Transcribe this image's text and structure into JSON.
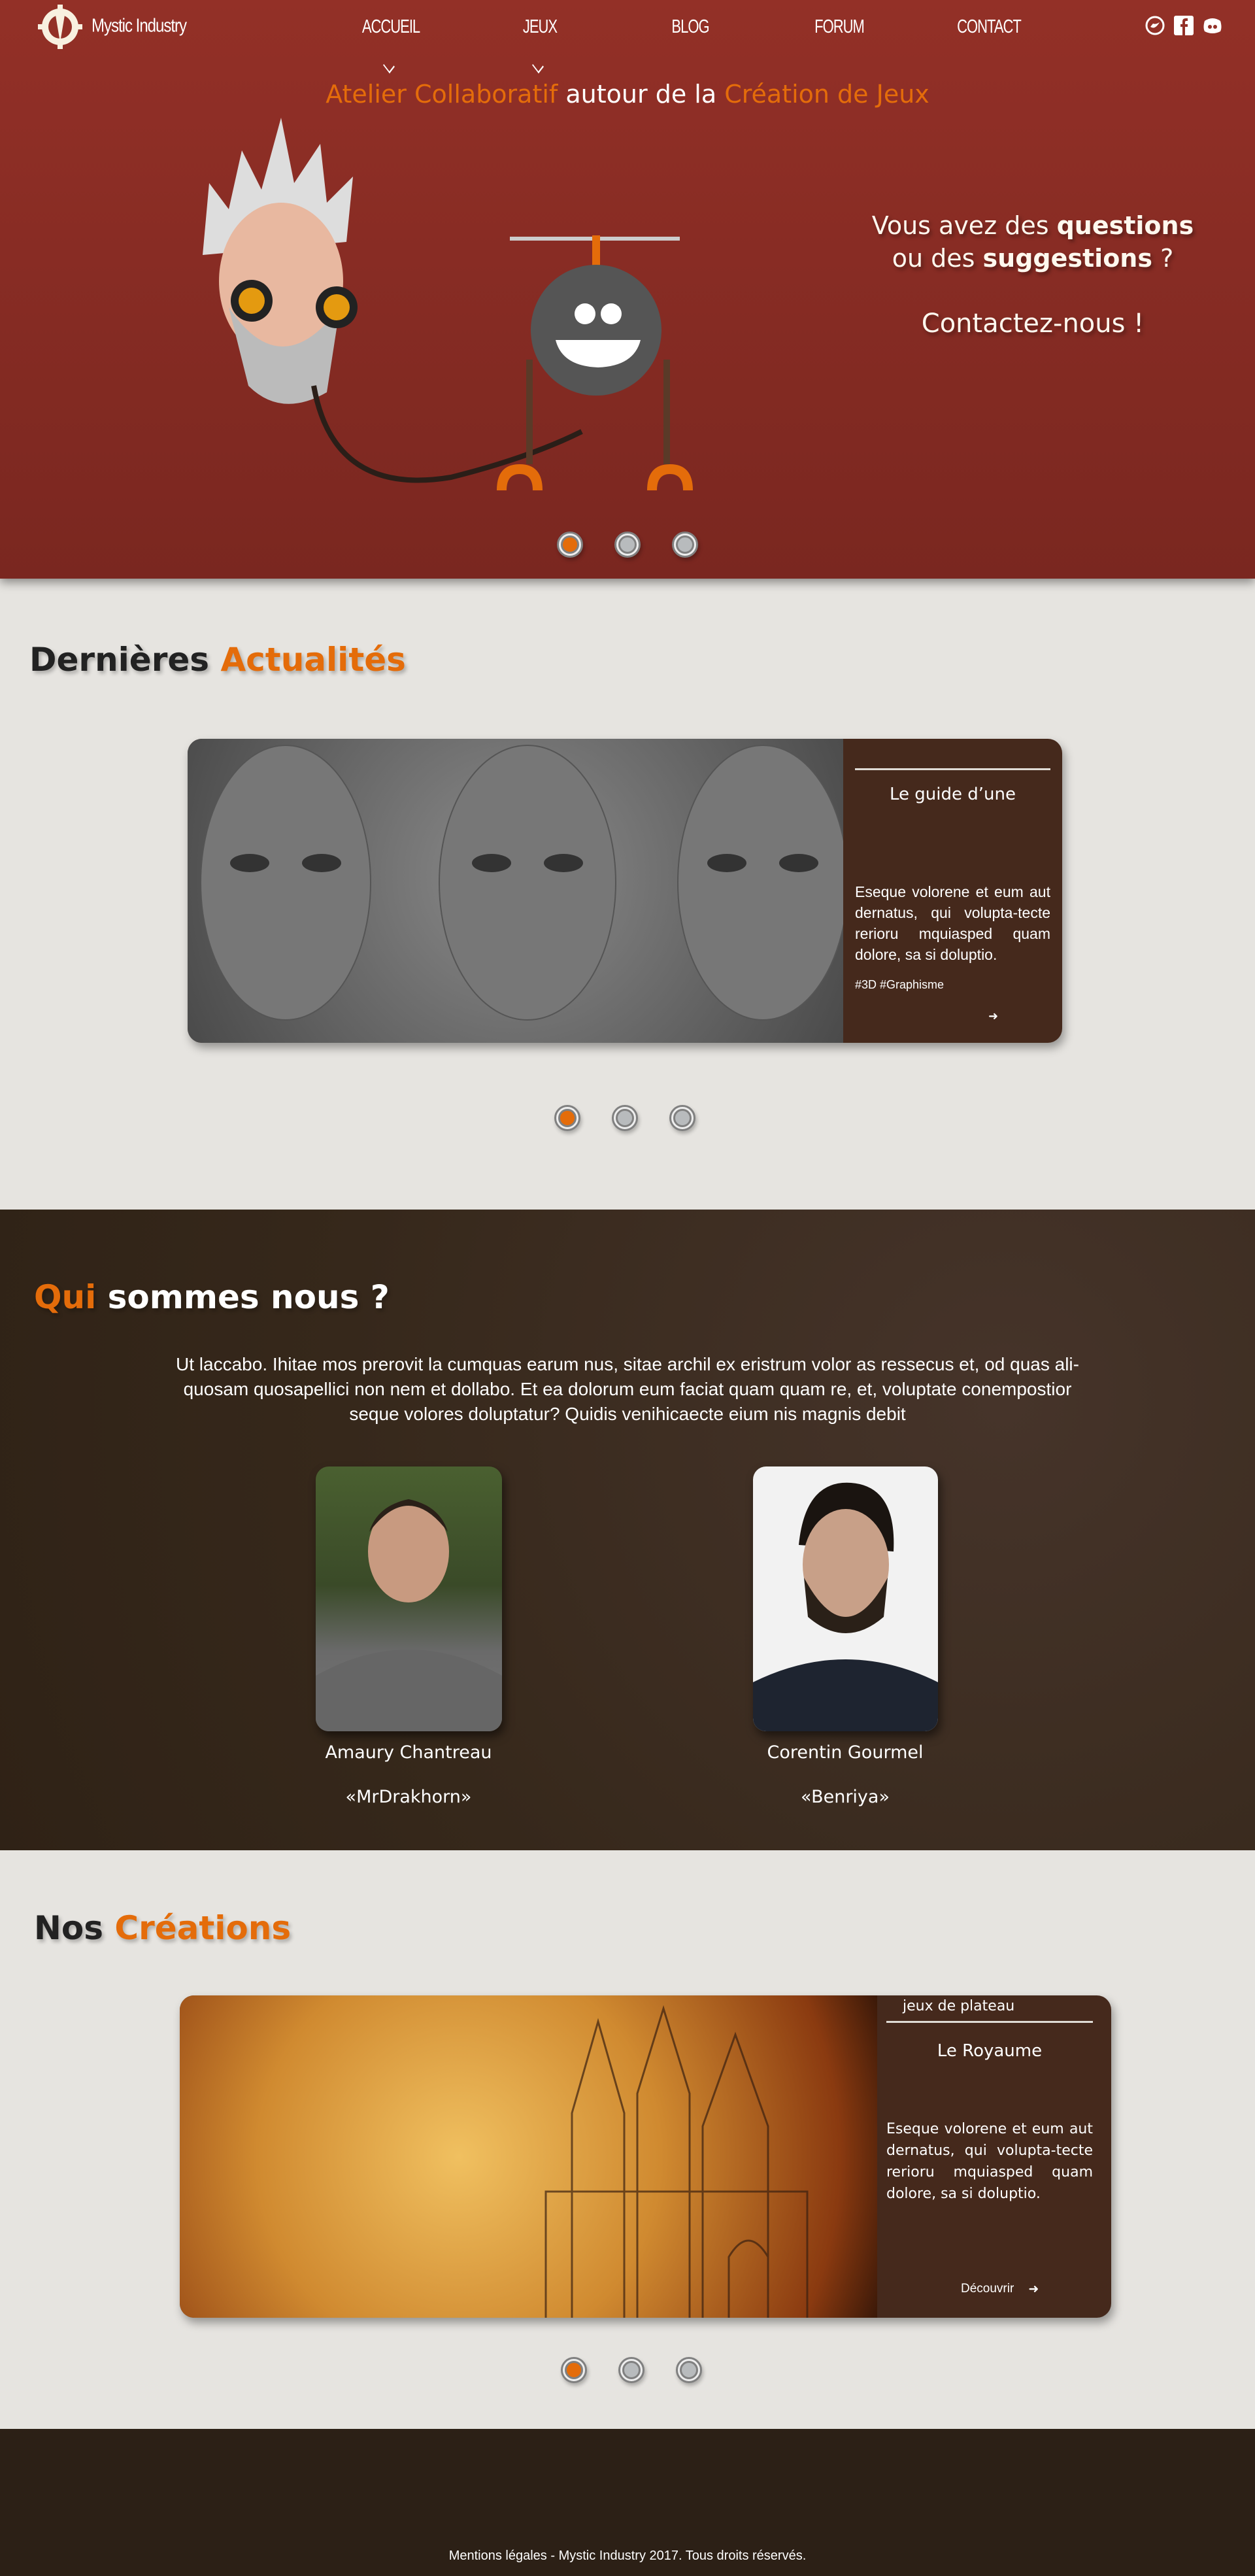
{
  "brand": {
    "name": "Mystic Industry"
  },
  "nav": [
    {
      "label": "Accueil",
      "dropdown": true
    },
    {
      "label": "Jeux",
      "dropdown": true
    },
    {
      "label": "Blog"
    },
    {
      "label": "Forum"
    },
    {
      "label": "Contact"
    }
  ],
  "social": [
    "twitter-icon",
    "facebook-icon",
    "discord-icon"
  ],
  "hero": {
    "tagline": {
      "p1": "Atelier Collaboratif",
      "p2": " autour de la ",
      "p3": "Création de Jeux"
    },
    "contact": {
      "l1a": "Vous avez des ",
      "l1b": "questions",
      "l2a": "ou des ",
      "l2b": "suggestions",
      "l2c": " ?",
      "cta": "Contactez-nous !"
    },
    "carousel": {
      "active": 1,
      "count": 3
    }
  },
  "news": {
    "title_a": "Dernières ",
    "title_b": "Actualités",
    "card": {
      "title": "Le guide d’une",
      "text": "Eseque volorene et eum aut dernatus, qui volupta-tecte rerioru mquiasped quam dolore, sa si doluptio.",
      "tags": "#3D #Graphisme",
      "arrow": "➜"
    },
    "carousel": {
      "active": 1,
      "count": 3
    }
  },
  "about": {
    "title_a": "Qui",
    "title_b": " sommes nous ?",
    "text": "Ut laccabo. Ihitae mos prerovit la cumquas earum nus, sitae archil ex eristrum volor as ressecus et, od quas ali-quosam quosapellici non nem et dollabo. Et ea dolorum eum faciat quam quam re, et, voluptate conempostior seque volores doluptatur? Quidis venihicaecte eium nis magnis debit",
    "members": [
      {
        "name": "Amaury Chantreau",
        "handle": "«MrDrakhorn»"
      },
      {
        "name": "Corentin Gourmel",
        "handle": "«Benriya»"
      }
    ]
  },
  "creations": {
    "title_a": "Nos ",
    "title_b": "Créations",
    "card": {
      "category": "jeux de plateau",
      "title": "Le Royaume",
      "text": "Eseque volorene et eum aut dernatus, qui volupta-tecte rerioru mquiasped quam dolore, sa si doluptio.",
      "cta": "Découvrir",
      "arrow": "➜"
    },
    "carousel": {
      "active": 1,
      "count": 3
    }
  },
  "footer": {
    "text": "Mentions légales - Mystic Industry 2017. Tous droits réservés."
  },
  "colors": {
    "accent": "#e46c0a",
    "hero": "#933027",
    "panel": "#45291c",
    "about_bg": "#3a2a1c",
    "footer": "#2c2016"
  }
}
